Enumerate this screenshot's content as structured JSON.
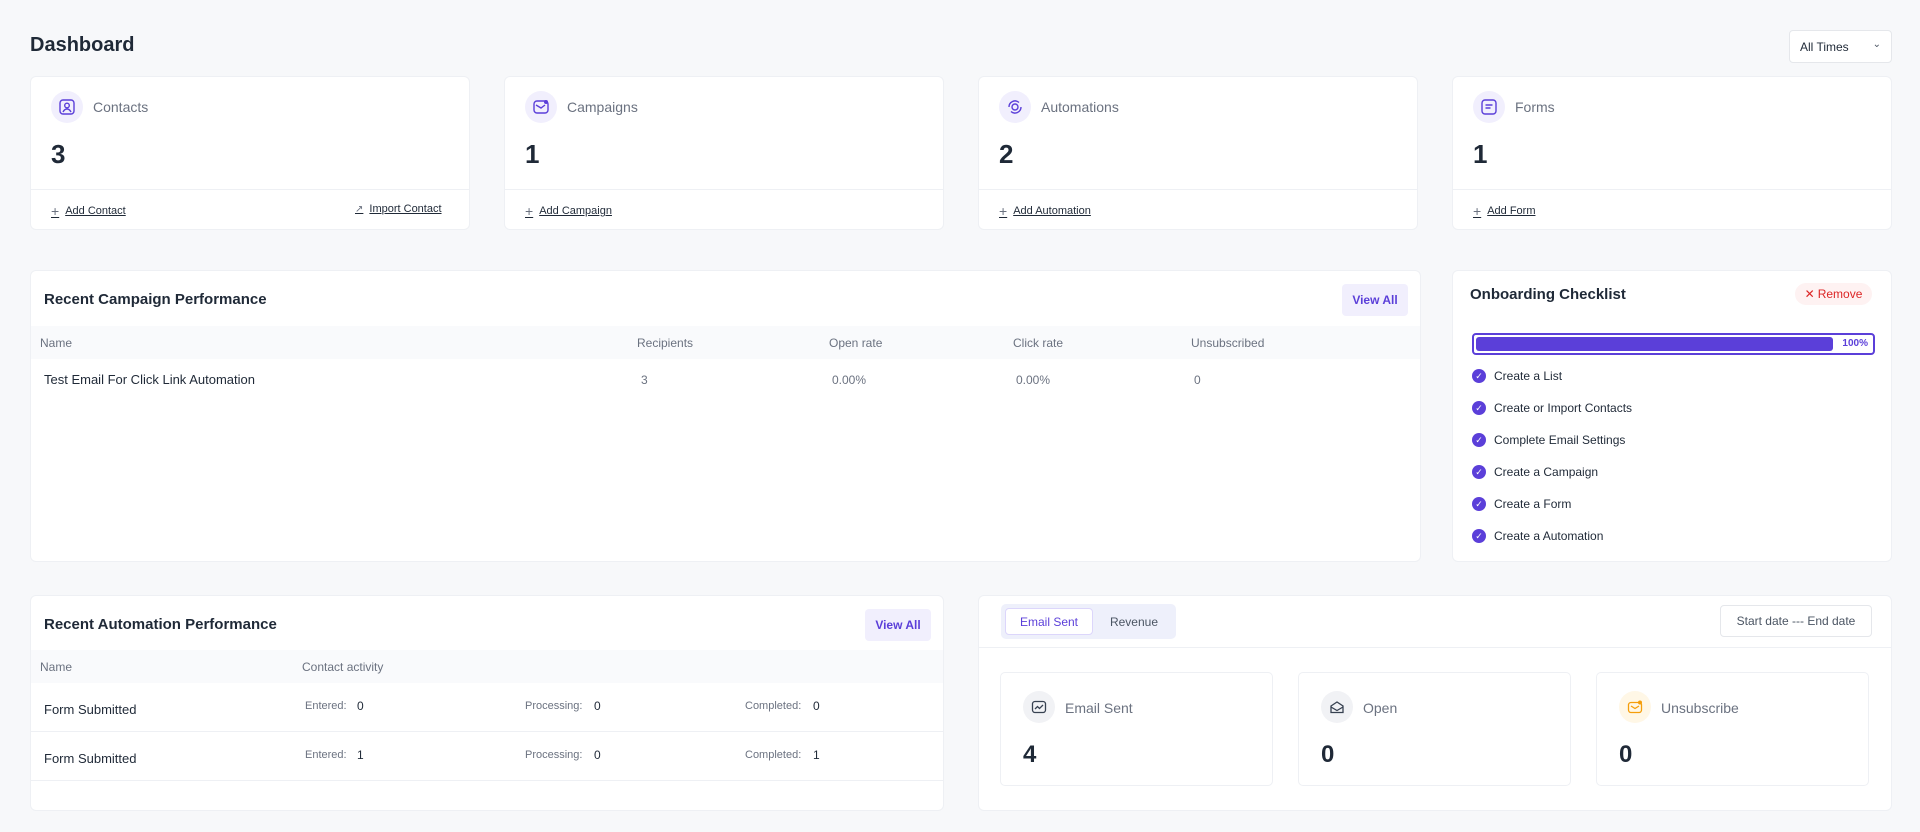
{
  "page": {
    "title": "Dashboard",
    "time_filter": "All Times"
  },
  "stats": {
    "contacts": {
      "label": "Contacts",
      "value": "3",
      "add": "Add Contact",
      "import": "Import Contact"
    },
    "campaigns": {
      "label": "Campaigns",
      "value": "1",
      "add": "Add Campaign"
    },
    "automations": {
      "label": "Automations",
      "value": "2",
      "add": "Add Automation"
    },
    "forms": {
      "label": "Forms",
      "value": "1",
      "add": "Add Form"
    }
  },
  "campaign_performance": {
    "title": "Recent Campaign Performance",
    "view_all": "View All",
    "columns": [
      "Name",
      "Recipients",
      "Open rate",
      "Click rate",
      "Unsubscribed"
    ],
    "rows": [
      {
        "name": "Test Email For Click Link Automation",
        "recipients": "3",
        "open_rate": "0.00%",
        "click_rate": "0.00%",
        "unsubscribed": "0"
      }
    ]
  },
  "onboarding": {
    "title": "Onboarding Checklist",
    "remove": "Remove",
    "progress": 100,
    "progress_label": "100%",
    "items": [
      "Create a List",
      "Create or Import Contacts",
      "Complete Email Settings",
      "Create a Campaign",
      "Create a Form",
      "Create a Automation"
    ]
  },
  "automation_performance": {
    "title": "Recent Automation Performance",
    "view_all": "View All",
    "columns": [
      "Name",
      "Contact activity"
    ],
    "entered_label": "Entered:",
    "processing_label": "Processing:",
    "completed_label": "Completed:",
    "rows": [
      {
        "name": "Form Submitted",
        "entered": "0",
        "processing": "0",
        "completed": "0"
      },
      {
        "name": "Form Submitted",
        "entered": "1",
        "processing": "0",
        "completed": "1"
      }
    ]
  },
  "email_stats": {
    "tabs": [
      "Email Sent",
      "Revenue"
    ],
    "active_tab": "Email Sent",
    "date_range": "Start date --- End date",
    "cards": [
      {
        "label": "Email Sent",
        "value": "4"
      },
      {
        "label": "Open",
        "value": "0"
      },
      {
        "label": "Unsubscribe",
        "value": "0"
      }
    ]
  },
  "colors": {
    "accent": "#5b3fd9",
    "danger": "#dc2626",
    "warning": "#f59e0b"
  }
}
